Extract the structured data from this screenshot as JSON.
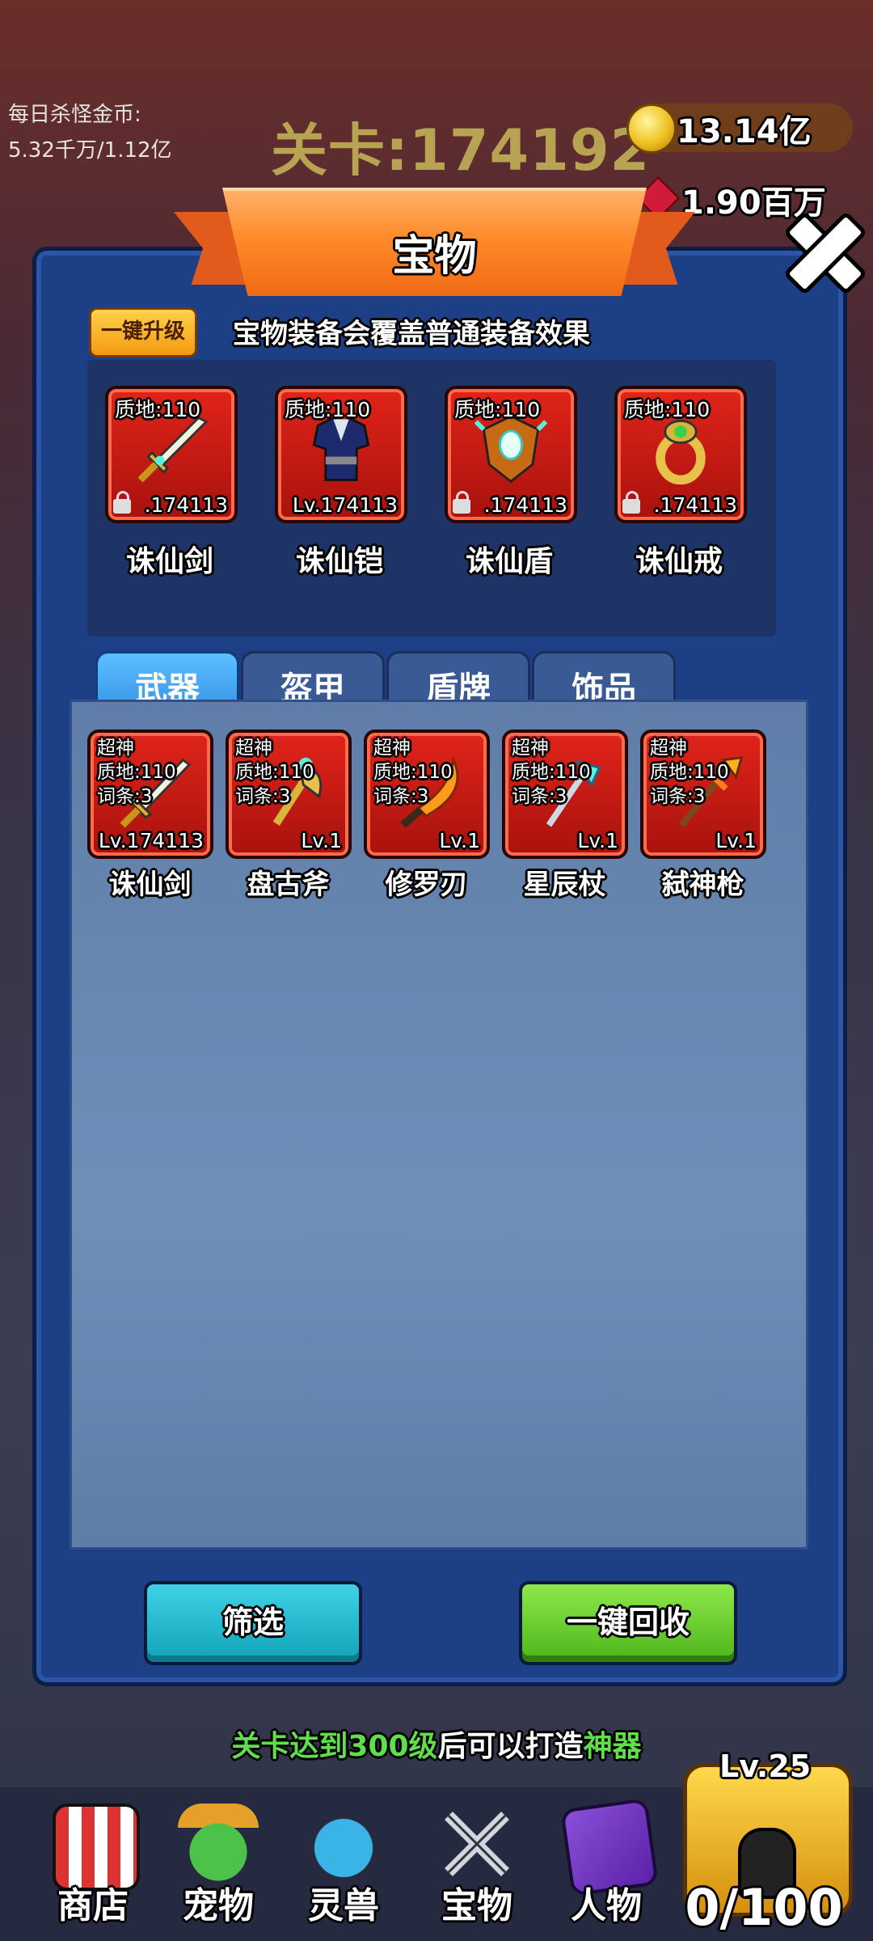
{
  "hud": {
    "daily_label": "每日杀怪金币:",
    "daily_value": "5.32千万/1.12亿",
    "stage": "关卡:174192",
    "gold": "13.14亿",
    "gems": "1.90百万"
  },
  "panel": {
    "title": "宝物",
    "upgrade_all": "一键升级",
    "notice": "宝物装备会覆盖普通装备效果",
    "equipped": [
      {
        "name": "诛仙剑",
        "quality": "质地:110",
        "level": ".174113",
        "icon": "sword-icon"
      },
      {
        "name": "诛仙铠",
        "quality": "质地:110",
        "level": "Lv.174113",
        "icon": "armor-icon"
      },
      {
        "name": "诛仙盾",
        "quality": "质地:110",
        "level": ".174113",
        "icon": "shield-icon"
      },
      {
        "name": "诛仙戒",
        "quality": "质地:110",
        "level": ".174113",
        "icon": "ring-icon"
      }
    ],
    "tabs": [
      "武器",
      "盔甲",
      "盾牌",
      "饰品"
    ],
    "active_tab": "武器",
    "items": [
      {
        "name": "诛仙剑",
        "tier": "超神",
        "quality": "质地:110",
        "affix": "词条:3",
        "level": "Lv.174113"
      },
      {
        "name": "盘古斧",
        "tier": "超神",
        "quality": "质地:110",
        "affix": "词条:3",
        "level": "Lv.1"
      },
      {
        "name": "修罗刃",
        "tier": "超神",
        "quality": "质地:110",
        "affix": "词条:3",
        "level": "Lv.1"
      },
      {
        "name": "星辰杖",
        "tier": "超神",
        "quality": "质地:110",
        "affix": "词条:3",
        "level": "Lv.1"
      },
      {
        "name": "弑神枪",
        "tier": "超神",
        "quality": "质地:110",
        "affix": "词条:3",
        "level": "Lv.1"
      }
    ],
    "filter_label": "筛选",
    "recycle_label": "一键回收"
  },
  "hint": {
    "part1": "关卡达到",
    "part2": "300级",
    "part3": "后可以打造",
    "part4": "神器"
  },
  "nav": [
    {
      "label": "商店",
      "icon": "shop-icon"
    },
    {
      "label": "宠物",
      "icon": "pet-icon"
    },
    {
      "label": "灵兽",
      "icon": "beast-icon"
    },
    {
      "label": "宝物",
      "icon": "treasure-icon"
    },
    {
      "label": "人物",
      "icon": "character-book-icon"
    }
  ],
  "chest": {
    "level": "Lv.25",
    "count": "0/100"
  },
  "colors": {
    "panel": "#1d3f86",
    "ribbon": "#ff8a2a",
    "card": "#d31d16",
    "filter_button": "#11a2b8",
    "recycle_button": "#4cb51c",
    "hint_green": "#5fe04a"
  }
}
